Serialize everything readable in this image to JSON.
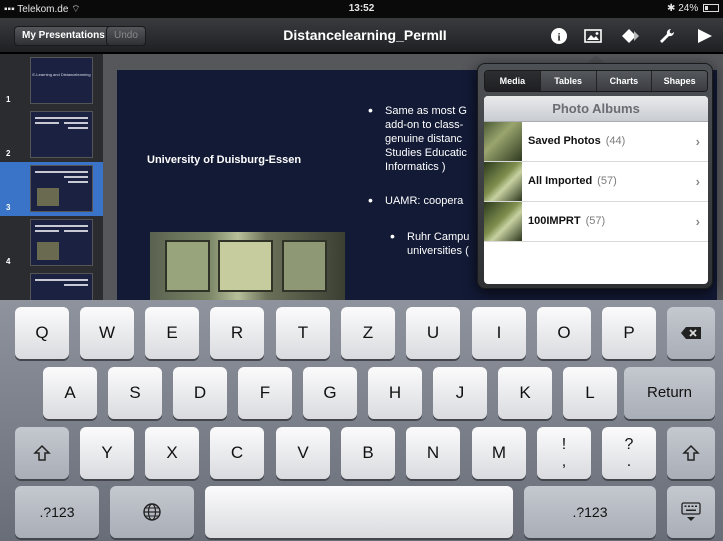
{
  "status_bar": {
    "carrier": "Telekom.de",
    "time": "13:52",
    "battery": "24%"
  },
  "toolbar": {
    "my_presentations": "My Presentations",
    "undo": "Undo",
    "title": "Distancelearning_PermII",
    "icons": [
      "info-icon",
      "media-icon",
      "animation-icon",
      "wrench-icon",
      "play-icon"
    ]
  },
  "navigator": {
    "slides": [
      {
        "number": "1",
        "text": "E-Learning and Distancelearning"
      },
      {
        "number": "2",
        "text": ""
      },
      {
        "number": "3",
        "text": ""
      },
      {
        "number": "4",
        "text": ""
      },
      {
        "number": "",
        "text": ""
      }
    ],
    "selected": "3"
  },
  "slide": {
    "university": "University of Duisburg-Essen",
    "bullet1": "Same as most G… add-on to class-… genuine distanc… Studies Educatio… Informatics )",
    "bullet1_lines": [
      "Same as most G",
      "add-on to class-",
      "genuine distanc",
      "Studies Educatic",
      "Informatics )"
    ],
    "bullet2": "UAMR: coopera",
    "bullet3_lines": [
      "Ruhr Campu",
      "universities ("
    ]
  },
  "popover": {
    "tabs": [
      "Media",
      "Tables",
      "Charts",
      "Shapes"
    ],
    "active_tab": "Media",
    "header": "Photo Albums",
    "albums": [
      {
        "name": "Saved Photos",
        "count": "(44)"
      },
      {
        "name": "All Imported",
        "count": "(57)"
      },
      {
        "name": "100IMPRT",
        "count": "(57)"
      }
    ]
  },
  "keyboard": {
    "row1": [
      "Q",
      "W",
      "E",
      "R",
      "T",
      "Z",
      "U",
      "I",
      "O",
      "P"
    ],
    "row2": [
      "A",
      "S",
      "D",
      "F",
      "G",
      "H",
      "J",
      "K",
      "L"
    ],
    "row3": [
      "Y",
      "X",
      "C",
      "V",
      "B",
      "N",
      "M"
    ],
    "return": "Return",
    "numbers_left": ".?123",
    "numbers_right": ".?123",
    "exclam_top": "!",
    "exclam_bottom": ",",
    "question_top": "?",
    "question_bottom": "."
  }
}
